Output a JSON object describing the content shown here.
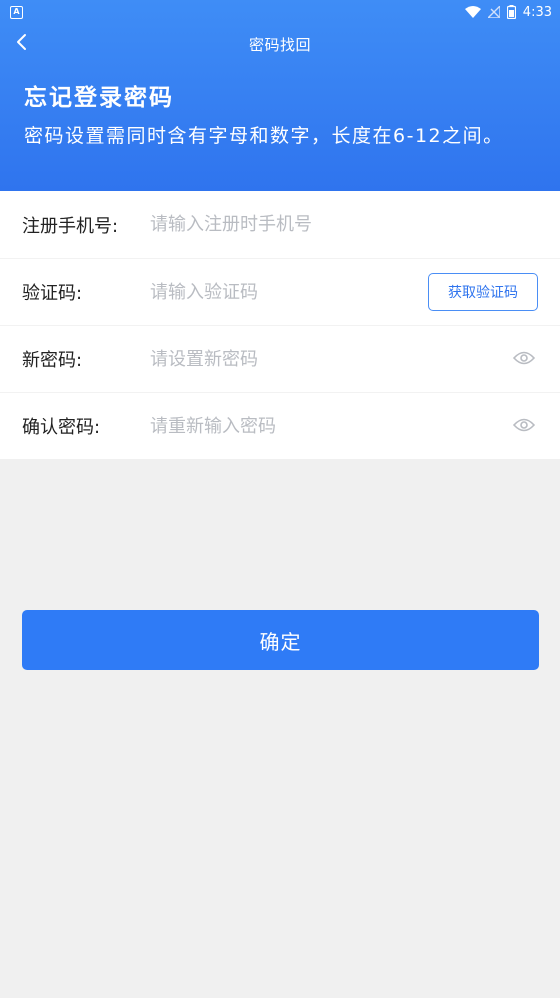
{
  "status_bar": {
    "app_badge": "A",
    "time": "4:33"
  },
  "nav": {
    "title": "密码找回",
    "back_icon": "chevron-left-icon"
  },
  "hero": {
    "title": "忘记登录密码",
    "description": "密码设置需同时含有字母和数字，长度在6-12之间。"
  },
  "form": {
    "phone": {
      "label": "注册手机号:",
      "placeholder": "请输入注册时手机号",
      "value": ""
    },
    "code": {
      "label": "验证码:",
      "placeholder": "请输入验证码",
      "value": "",
      "button": "获取验证码"
    },
    "new_password": {
      "label": "新密码:",
      "placeholder": "请设置新密码",
      "value": "",
      "icon": "eye-icon"
    },
    "confirm_password": {
      "label": "确认密码:",
      "placeholder": "请重新输入密码",
      "value": "",
      "icon": "eye-icon"
    }
  },
  "confirm_button": {
    "label": "确定"
  },
  "colors": {
    "primary": "#2f7bf6",
    "hero_top": "#3f8df6",
    "hero_bottom": "#2f74ee",
    "background": "#f0f0f0",
    "placeholder": "#b9bcc2"
  }
}
